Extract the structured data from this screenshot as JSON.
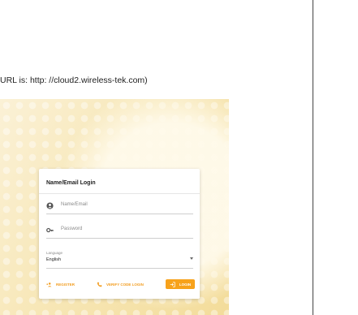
{
  "caption": "URL is: http: //cloud2.wireless-tek.com)",
  "login_card": {
    "title": "Name/Email Login",
    "email_placeholder": "Name/Email",
    "password_placeholder": "Password",
    "language_label": "Language",
    "language_value": "English",
    "register_label": "REGISTER",
    "verify_code_label": "VERIFY CODE LOGIN",
    "login_label": "LOGIN"
  },
  "colors": {
    "accent": "#f7a21b",
    "background_gold": "#f3dc9a"
  },
  "icons": {
    "email": "account-circle-icon",
    "password": "key-icon",
    "register": "add-user-icon",
    "verify": "phone-icon",
    "login": "login-icon",
    "language": "chevron-down-icon"
  }
}
